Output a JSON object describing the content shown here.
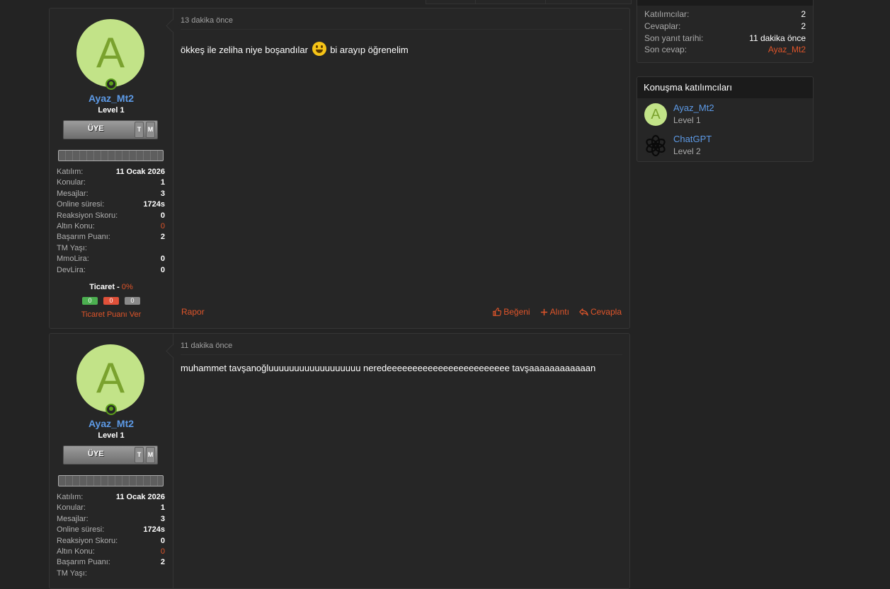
{
  "posts": [
    {
      "date": "13 dakika önce",
      "body_before_emoji": "ökkeş ile zeliha niye boşandılar",
      "body_after_emoji": "bi arayıp öğrenelim",
      "emoji": "grinning-face-emoji",
      "user": {
        "avatar_letter": "A",
        "name": "Ayaz_Mt2",
        "level": "Level 1",
        "rank_label": "ÜYE",
        "rank_tag_1": "T",
        "rank_tag_2": "M",
        "stats": [
          {
            "label": "Katılım:",
            "value": "11 Ocak 2026"
          },
          {
            "label": "Konular:",
            "value": "1"
          },
          {
            "label": "Mesajlar:",
            "value": "3"
          },
          {
            "label": "Online süresi:",
            "value": "1724s"
          },
          {
            "label": "Reaksiyon Skoru:",
            "value": "0"
          },
          {
            "label": "Altın Konu:",
            "value": "0"
          },
          {
            "label": "Başarım Puanı:",
            "value": "2"
          },
          {
            "label": "TM Yaşı:",
            "value": ""
          },
          {
            "label": "MmoLira:",
            "value": "0"
          },
          {
            "label": "DevLira:",
            "value": "0"
          }
        ],
        "trade_label": "Ticaret -",
        "trade_percent": "0%",
        "trade_positive": "0",
        "trade_negative": "0",
        "trade_neutral": "0",
        "trade_give": "Ticaret Puanı Ver"
      },
      "report": "Rapor",
      "like": "Beğeni",
      "quote": "Alıntı",
      "reply": "Cevapla"
    },
    {
      "date": "11 dakika önce",
      "body": "muhammet tavşanoğluuuuuuuuuuuuuuuuuu neredeeeeeeeeeeeeeeeeeeeeeeee tavşaaaaaaaaaaaan",
      "user": {
        "avatar_letter": "A",
        "name": "Ayaz_Mt2",
        "level": "Level 1",
        "rank_label": "ÜYE",
        "rank_tag_1": "T",
        "rank_tag_2": "M",
        "stats": [
          {
            "label": "Katılım:",
            "value": "11 Ocak 2026"
          },
          {
            "label": "Konular:",
            "value": "1"
          },
          {
            "label": "Mesajlar:",
            "value": "3"
          },
          {
            "label": "Online süresi:",
            "value": "1724s"
          },
          {
            "label": "Reaksiyon Skoru:",
            "value": "0"
          },
          {
            "label": "Altın Konu:",
            "value": "0"
          },
          {
            "label": "Başarım Puanı:",
            "value": "2"
          },
          {
            "label": "TM Yaşı:",
            "value": ""
          }
        ]
      }
    }
  ],
  "thread_info": {
    "rows": [
      {
        "label": "Katılımcılar:",
        "value": "2"
      },
      {
        "label": "Cevaplar:",
        "value": "2"
      },
      {
        "label": "Son yanıt tarihi:",
        "value": "11 dakika önce"
      },
      {
        "label": "Son cevap:",
        "value": "Ayaz_Mt2"
      }
    ]
  },
  "participants": {
    "title": "Konuşma katılımcıları",
    "items": [
      {
        "avatar_letter": "A",
        "name": "Ayaz_Mt2",
        "level": "Level 1"
      },
      {
        "name": "ChatGPT",
        "level": "Level 2",
        "icon": "openai-logo-icon"
      }
    ]
  },
  "colors": {
    "background": "#232323",
    "panel": "#262626",
    "accent": "#e0552a",
    "username": "#5d9ae6",
    "avatar_bg": "#c2e388",
    "online": "#5c9f1a",
    "trade_positive": "#4caf50",
    "trade_negative": "#e0513a",
    "trade_neutral": "#8a8a8a"
  }
}
